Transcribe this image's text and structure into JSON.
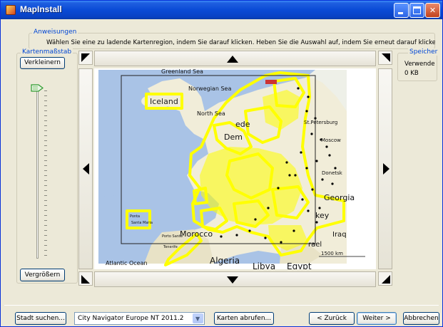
{
  "window": {
    "title": "MapInstall"
  },
  "instructions": {
    "legend": "Anweisungen",
    "text": "Wählen Sie eine zu ladende Kartenregion, indem Sie darauf klicken. Heben Sie die Auswahl auf, indem Sie erneut darauf klicken."
  },
  "scale": {
    "legend": "Kartenmaßstab",
    "zoom_out_label": "Verkleinern",
    "zoom_in_label": "Vergrößern"
  },
  "storage": {
    "legend": "Speicher",
    "label": "Verwende",
    "value": "0 KB"
  },
  "map": {
    "labels": {
      "greenland_sea": "Greenland Sea",
      "norwegian_sea": "Norwegian Sea",
      "iceland": "Iceland",
      "north_sea": "North Sea",
      "sweden_partial": "ede",
      "denmark_partial": "Dem",
      "st_petersburg": "St.Petersburg",
      "moscow": "Moscow",
      "donetsk": "Donetsk",
      "georgia": "Georgia",
      "turkey_partial": "key",
      "iraq": "Iraq",
      "israel_partial": "rael",
      "morocco": "Morocco",
      "algeria": "Algeria",
      "libya": "Libya",
      "egypt": "Egypt",
      "atlantic_ocean": "Atlantic Ocean",
      "scale_bar": "1500 km",
      "santa_maria": "Santa Maria",
      "porto_santo": "Porto Santo",
      "azores_partial": "Ponta",
      "canary_partial": "Tenerife"
    },
    "selection_color": "#ffff00",
    "water_color": "#a9c3e6",
    "land_color": "#f1edd9"
  },
  "footer": {
    "find_city_label": "Stadt suchen...",
    "map_product_value": "City Navigator Europe NT 2011.2",
    "fetch_maps_label": "Karten abrufen...",
    "back_label": "< Zurück",
    "next_label": "Weiter >",
    "cancel_label": "Abbrechen"
  },
  "colors": {
    "titlebar": "#0a4bd6",
    "legend_text": "#0046d5",
    "window_bg": "#ece9d8"
  }
}
